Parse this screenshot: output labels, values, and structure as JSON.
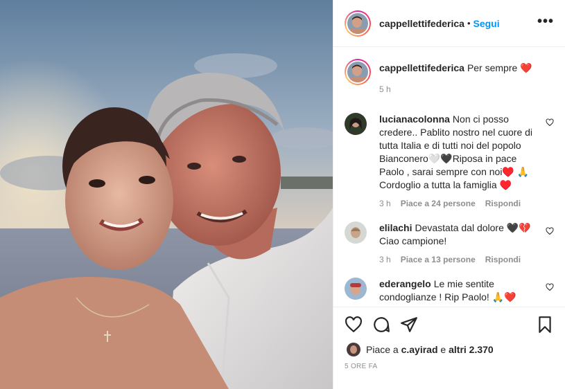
{
  "post": {
    "username": "cappellettifederica",
    "follow_label": "Segui",
    "separator": "•",
    "more_label": "•••"
  },
  "caption": {
    "username": "cappellettifederica",
    "text": "Per sempre ❤️",
    "time": "5 h"
  },
  "comments": [
    {
      "username": "lucianacolonna",
      "text": "Non ci posso credere.. Pablito nostro nel cuore di tutta Italia e di tutti noi del popolo Bianconero🤍🖤Riposa in pace Paolo , sarai sempre con noi♥️ 🙏Cordoglio a tutta la famiglia ♥️",
      "time": "3 h",
      "likes": "Piace a 24 persone",
      "reply": "Rispondi"
    },
    {
      "username": "elilachi",
      "text": "Devastata dal dolore 🖤💔 Ciao campione!",
      "time": "3 h",
      "likes": "Piace a 13 persone",
      "reply": "Rispondi"
    },
    {
      "username": "ederangelo",
      "text": "Le mie sentite condoglianze ! Rip Paolo! 🙏❤️",
      "time": "",
      "likes": "",
      "reply": ""
    }
  ],
  "footer": {
    "likes_prefix": "Piace a ",
    "likes_user": "c.ayirad",
    "likes_middle": " e ",
    "likes_others": "altri 2.370",
    "timestamp": "5 ORE FA"
  },
  "icons": {
    "like": "heart-icon",
    "comment": "comment-icon",
    "share": "share-icon",
    "save": "bookmark-icon",
    "more": "more-options-icon"
  },
  "colors": {
    "follow": "#0095f6",
    "meta": "#8e8e8e",
    "border": "#efefef"
  }
}
